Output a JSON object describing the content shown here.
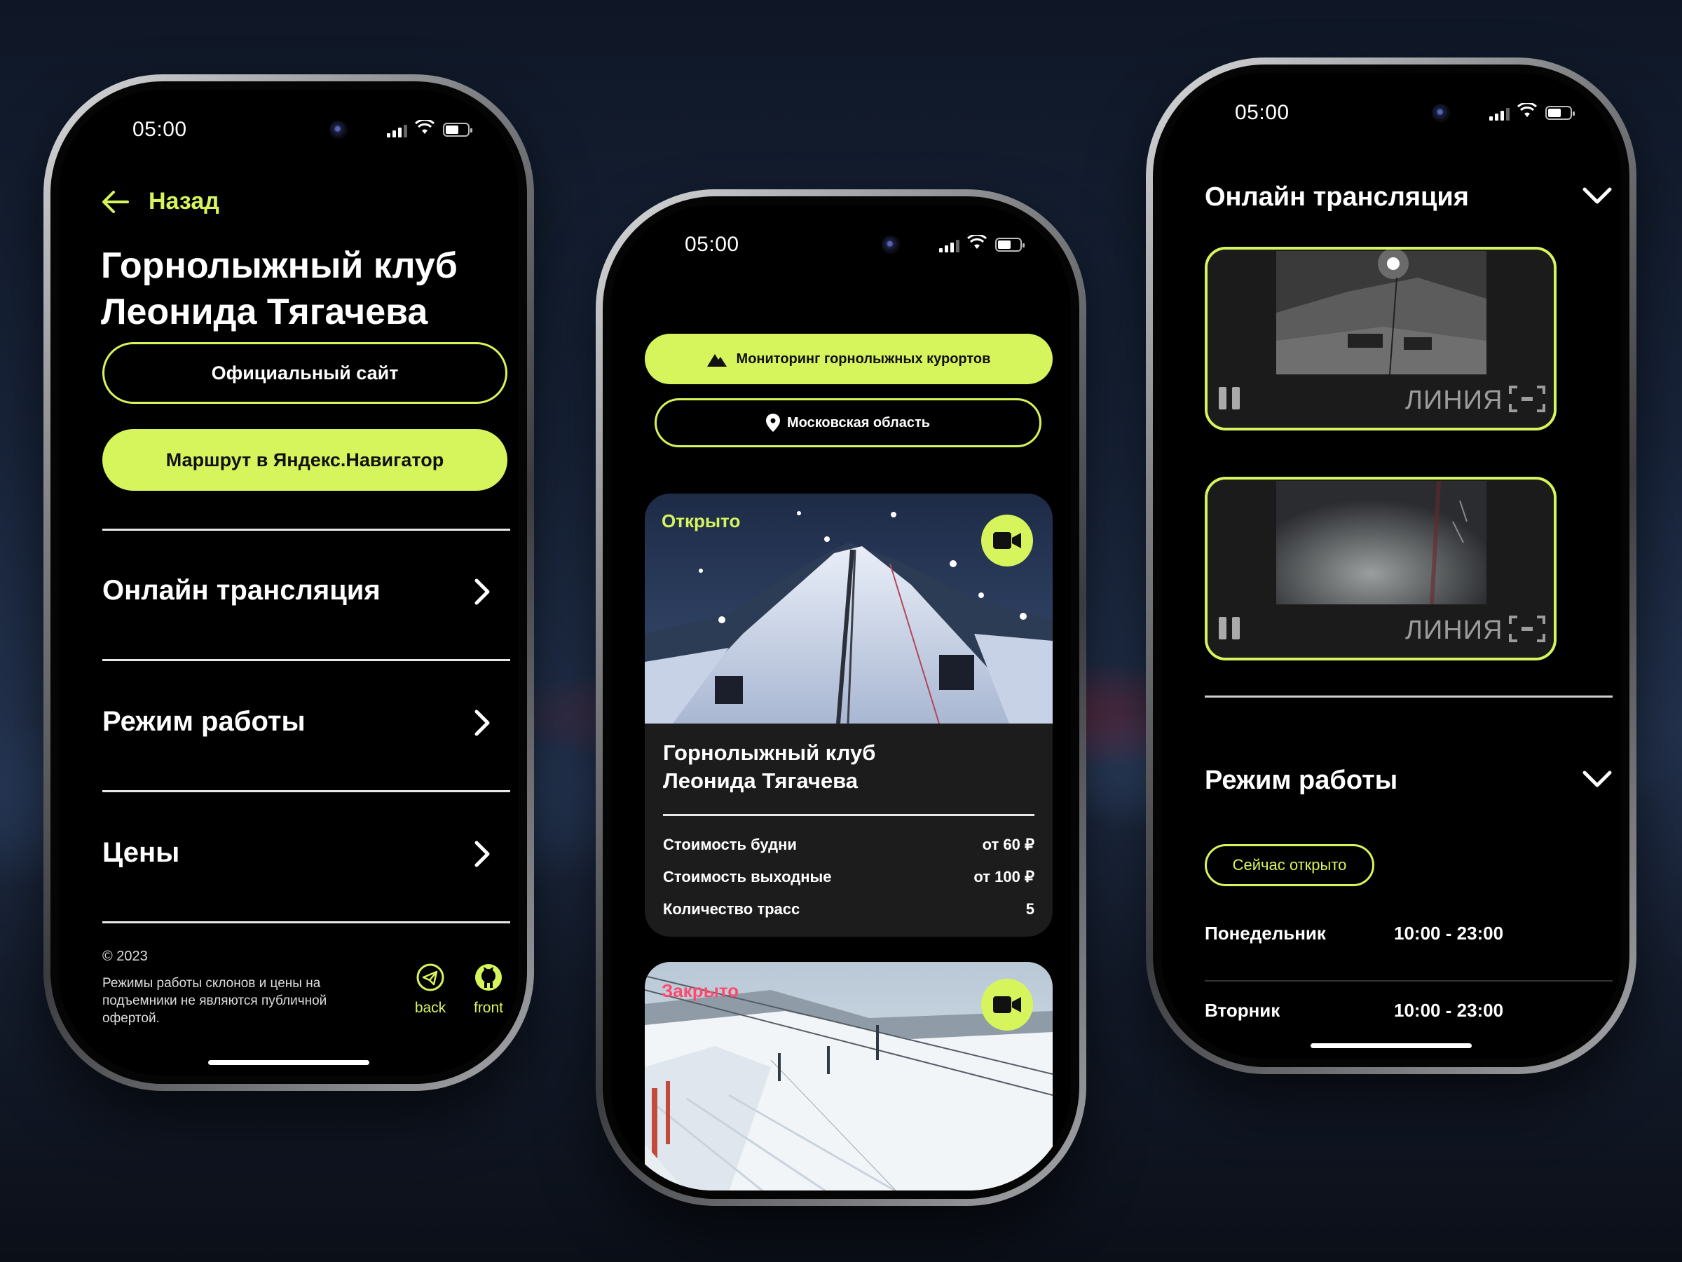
{
  "status_time": "05:00",
  "phone1": {
    "back_label": "Назад",
    "title_line1": "Горнолыжный клуб",
    "title_line2": "Леонида Тягачева",
    "official_site_button": "Официальный сайт",
    "route_button": "Маршрут в Яндекс.Навигатор",
    "menu": [
      {
        "label": "Онлайн трансляция"
      },
      {
        "label": "Режим работы"
      },
      {
        "label": "Цены"
      }
    ],
    "footer": {
      "copyright": "© 2023",
      "disclaimer": "Режимы работы склонов и цены на подъемники не являются публичной офертой.",
      "back_link": "back",
      "front_link": "front"
    }
  },
  "phone2": {
    "monitoring_button": "Мониторинг горнолыжных курортов",
    "region_button": "Московская область",
    "card1": {
      "status": "Открыто",
      "title_line1": "Горнолыжный клуб",
      "title_line2": "Леонида Тягачева",
      "rows": [
        {
          "label": "Стоимость будни",
          "value": "от 60 ₽"
        },
        {
          "label": "Стоимость выходные",
          "value": "от 100 ₽"
        },
        {
          "label": "Количество трасс",
          "value": "5"
        }
      ]
    },
    "card2": {
      "status": "Закрыто"
    }
  },
  "phone3": {
    "section1_title": "Онлайн трансляция",
    "streams": [
      {
        "logo": "ЛИНИЯ"
      },
      {
        "logo": "ЛИНИЯ"
      }
    ],
    "section2_title": "Режим работы",
    "open_badge": "Сейчас открыто",
    "schedule": [
      {
        "day": "Понедельник",
        "hours": "10:00 - 23:00"
      },
      {
        "day": "Вторник",
        "hours": "10:00 - 23:00"
      }
    ]
  },
  "colors": {
    "accent": "#d6f55c",
    "closed": "#ff4a6e",
    "bg": "#000000"
  }
}
